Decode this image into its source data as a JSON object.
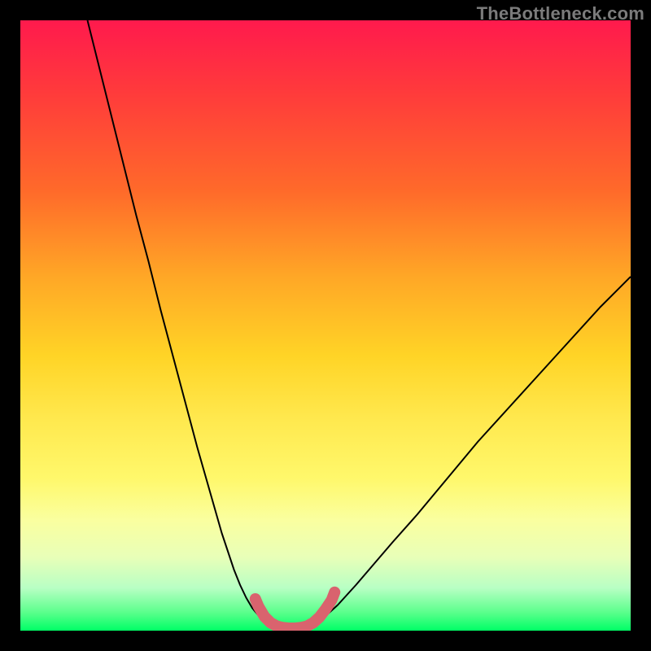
{
  "watermark": {
    "text": "TheBottleneck.com"
  },
  "chart_data": {
    "type": "line",
    "title": "",
    "xlabel": "",
    "ylabel": "",
    "xlim": [
      0,
      100
    ],
    "ylim": [
      0,
      100
    ],
    "series": [
      {
        "name": "left-branch",
        "x": [
          11,
          13,
          15,
          17,
          19,
          21,
          23,
          25,
          27,
          29,
          31,
          33,
          35,
          36,
          37,
          38,
          39,
          40,
          41
        ],
        "values": [
          100,
          92,
          84,
          76,
          68,
          60.5,
          52.5,
          45,
          37.5,
          30,
          23,
          16,
          10,
          7.5,
          5.4,
          3.7,
          2.5,
          1.6,
          1.0
        ]
      },
      {
        "name": "valley-floor",
        "x": [
          41,
          42,
          43,
          44,
          45,
          46,
          47,
          48
        ],
        "values": [
          1.0,
          0.6,
          0.4,
          0.35,
          0.35,
          0.4,
          0.6,
          1.0
        ]
      },
      {
        "name": "right-branch",
        "x": [
          48,
          49,
          50,
          52,
          55,
          58,
          61,
          65,
          70,
          75,
          80,
          85,
          90,
          95,
          100
        ],
        "values": [
          1.0,
          1.6,
          2.4,
          4.2,
          7.5,
          11,
          14.5,
          19,
          25,
          31,
          36.5,
          42,
          47.5,
          53,
          58
        ]
      },
      {
        "name": "valley-highlight",
        "x": [
          38.5,
          39,
          40,
          41,
          42,
          43,
          44,
          45,
          46,
          47,
          48,
          49,
          50,
          51,
          51.5
        ],
        "values": [
          5.2,
          4.0,
          2.3,
          1.3,
          0.75,
          0.5,
          0.4,
          0.4,
          0.5,
          0.75,
          1.3,
          2.2,
          3.5,
          5.0,
          6.3
        ]
      }
    ],
    "styles": {
      "left-branch": {
        "stroke": "#000000",
        "width": 2
      },
      "valley-floor": {
        "stroke": "#000000",
        "width": 2
      },
      "right-branch": {
        "stroke": "#000000",
        "width": 2
      },
      "valley-highlight": {
        "stroke": "#d9636e",
        "width": 14,
        "linecap": "round"
      }
    }
  }
}
